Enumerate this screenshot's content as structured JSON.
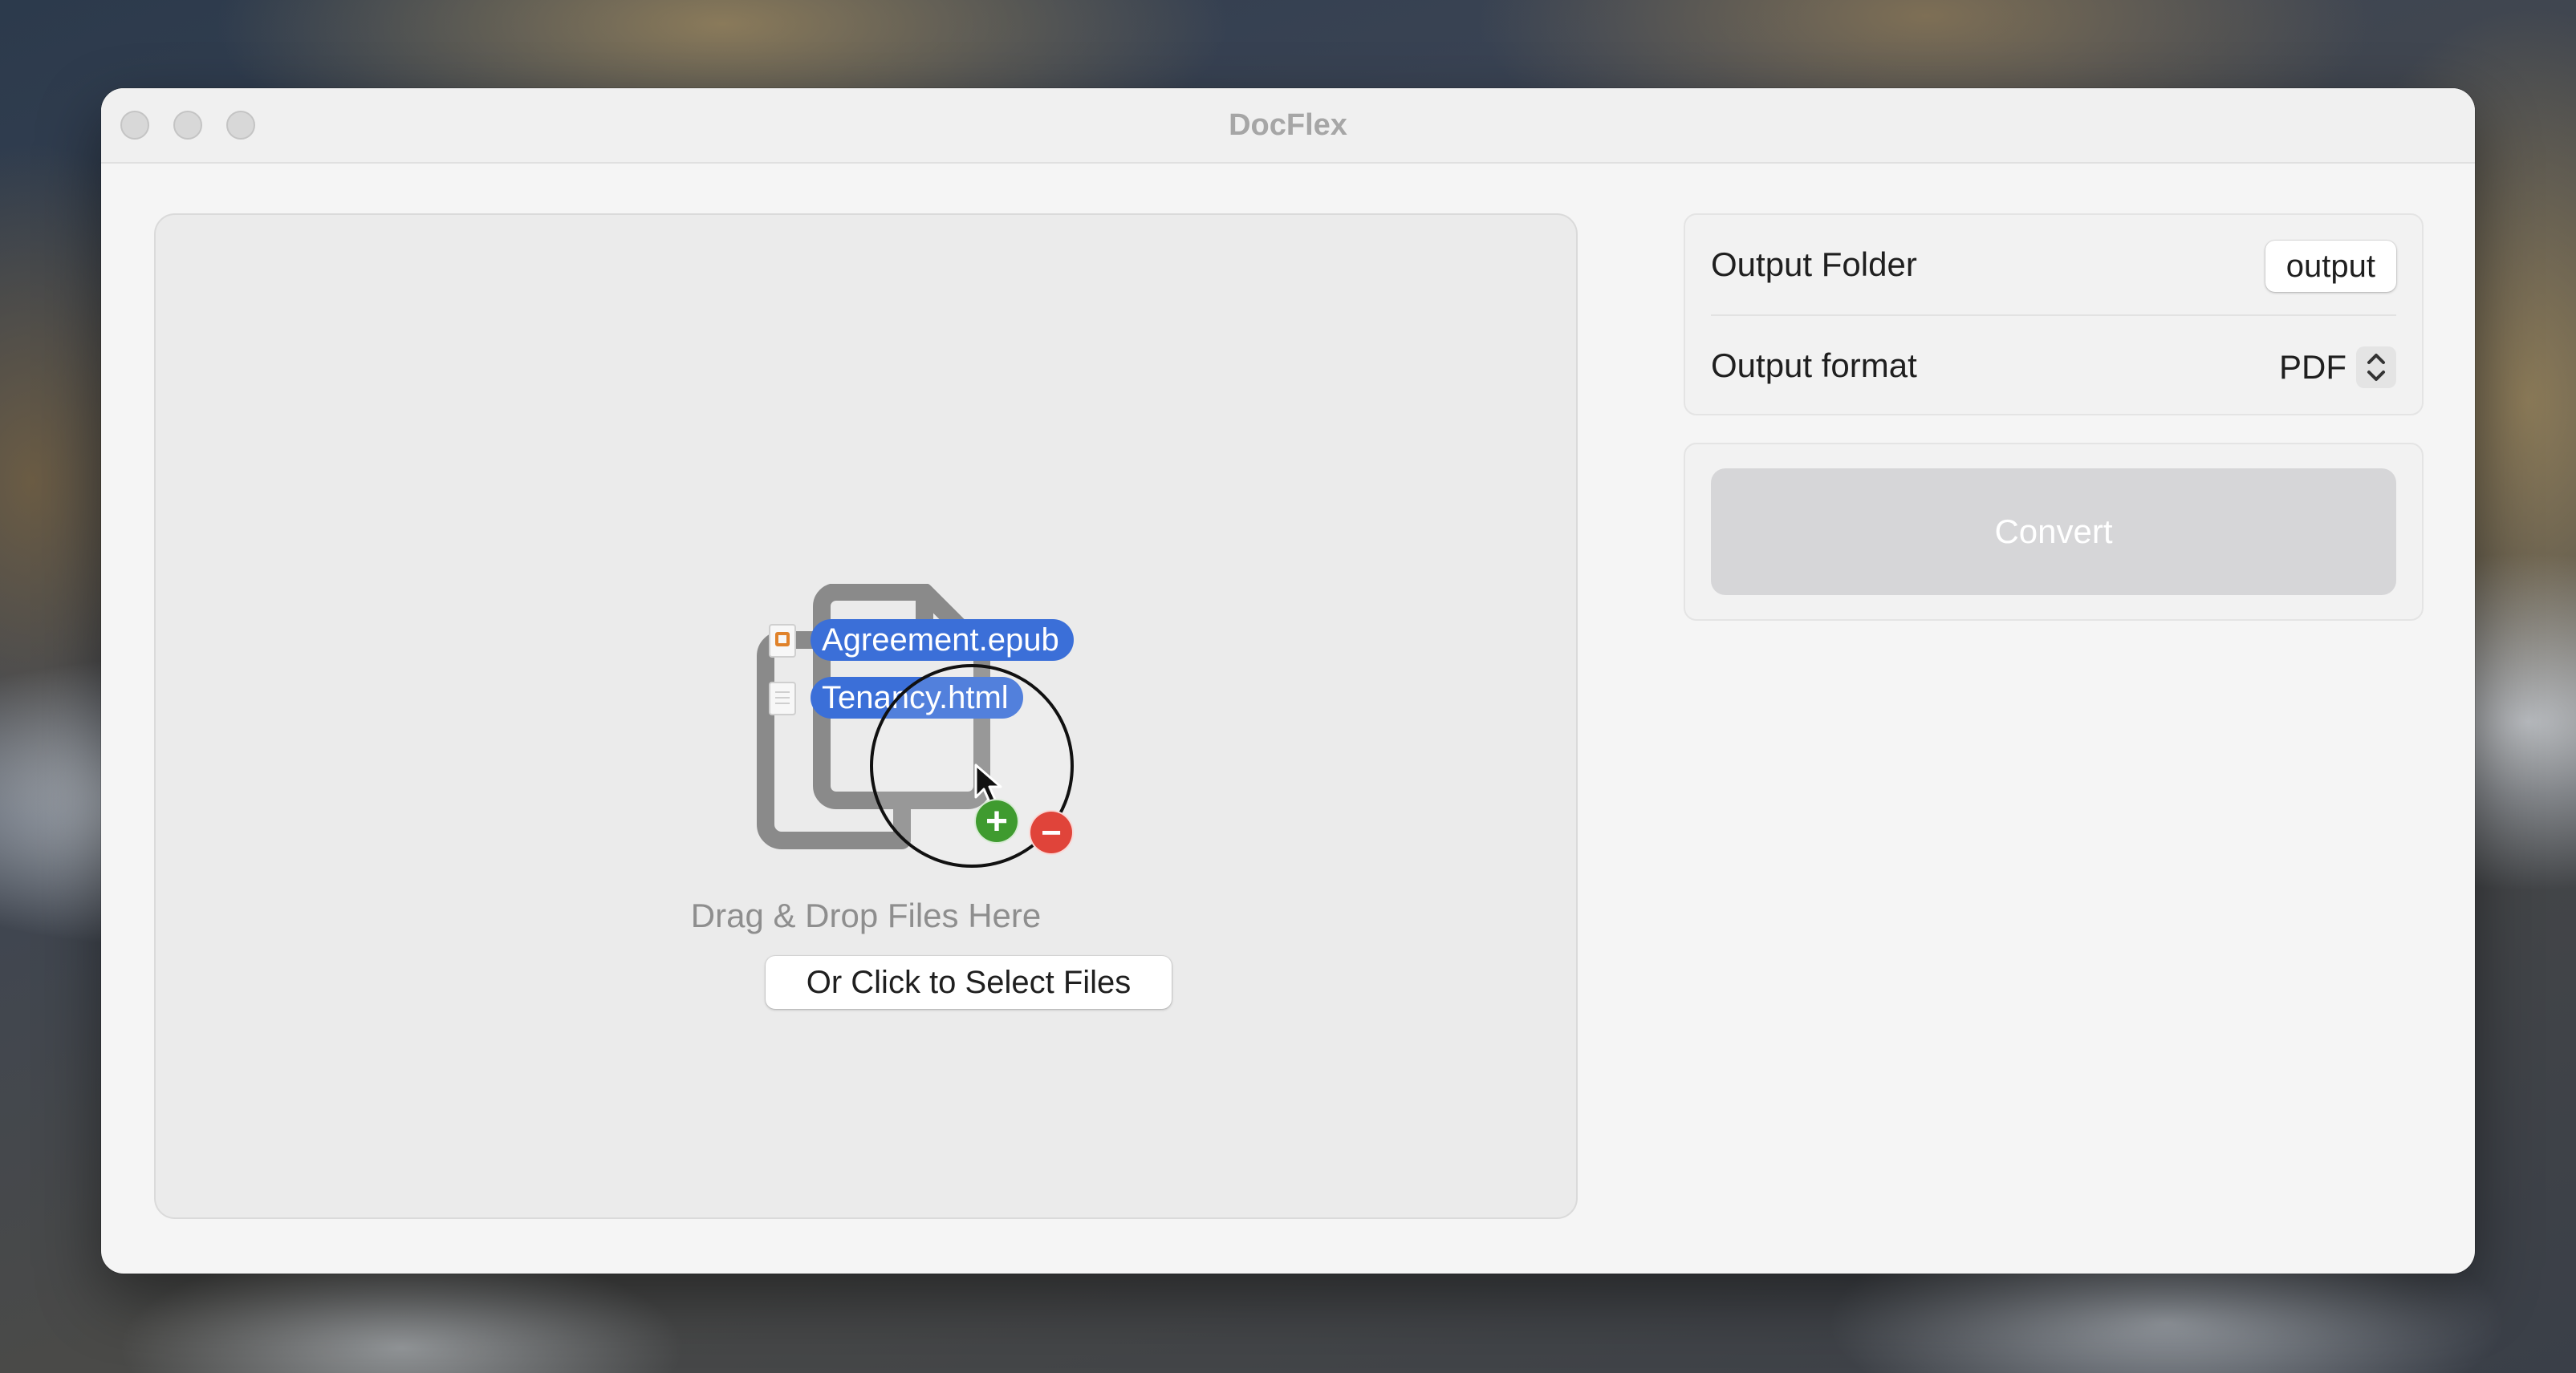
{
  "window": {
    "title": "DocFlex"
  },
  "drop_zone": {
    "drag_label": "Drag & Drop Files Here",
    "select_button": "Or Click to Select Files",
    "dragged_files": [
      {
        "name": "Agreement.epub",
        "icon": "epub-file-icon"
      },
      {
        "name": "Tenancy.html",
        "icon": "html-file-icon"
      }
    ],
    "drag_badges": [
      "plus-badge-icon",
      "minus-badge-icon"
    ]
  },
  "settings": {
    "output_folder_label": "Output Folder",
    "output_folder_value": "output",
    "output_format_label": "Output format",
    "output_format_value": "PDF"
  },
  "convert": {
    "label": "Convert",
    "enabled": false
  },
  "colors": {
    "selection_blue": "#3b6fd8",
    "convert_disabled": "#d6d6d8",
    "plus_green": "#3f9b2f",
    "minus_red": "#e0443a"
  }
}
